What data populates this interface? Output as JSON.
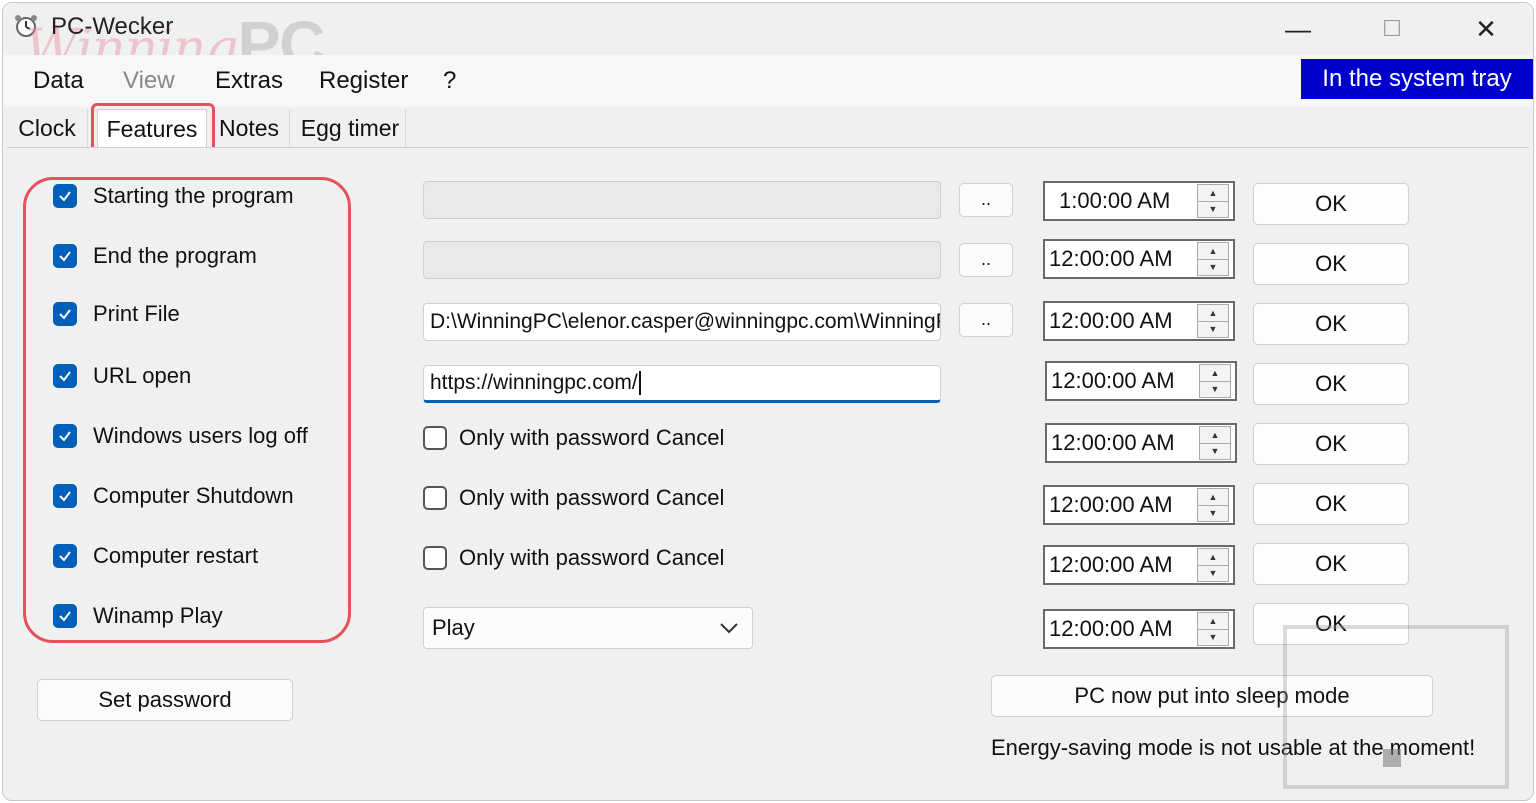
{
  "window": {
    "title": "PC-Wecker",
    "watermark_script": "Winning",
    "watermark_bold": "PC",
    "minimize": "—",
    "maximize": "☐",
    "close": "✕"
  },
  "menu": {
    "items": [
      {
        "label": "Data",
        "enabled": true
      },
      {
        "label": "View",
        "enabled": false
      },
      {
        "label": "Extras",
        "enabled": true
      },
      {
        "label": "Register",
        "enabled": true
      },
      {
        "label": "?",
        "enabled": true
      }
    ],
    "tray_button": "In the system tray"
  },
  "tabs": [
    {
      "label": "Clock",
      "active": false
    },
    {
      "label": "Features",
      "active": true
    },
    {
      "label": "Notes",
      "active": false
    },
    {
      "label": "Egg timer",
      "active": false
    }
  ],
  "features": [
    {
      "label": "Starting the program",
      "checked": true,
      "time": "1:00:00 AM",
      "ok": "OK"
    },
    {
      "label": "End the program",
      "checked": true,
      "time": "12:00:00 AM",
      "ok": "OK"
    },
    {
      "label": "Print File",
      "checked": true,
      "time": "12:00:00 AM",
      "ok": "OK"
    },
    {
      "label": "URL open",
      "checked": true,
      "time": "12:00:00 AM",
      "ok": "OK"
    },
    {
      "label": "Windows users log off",
      "checked": true,
      "time": "12:00:00 AM",
      "ok": "OK"
    },
    {
      "label": "Computer Shutdown",
      "checked": true,
      "time": "12:00:00 AM",
      "ok": "OK"
    },
    {
      "label": "Computer restart",
      "checked": true,
      "time": "12:00:00 AM",
      "ok": "OK"
    },
    {
      "label": "Winamp Play",
      "checked": true,
      "time": "12:00:00 AM",
      "ok": "OK"
    }
  ],
  "fields": {
    "start_program_path": "",
    "end_program_path": "",
    "print_file_path": "D:\\WinningPC\\elenor.casper@winningpc.com\\WinningPC",
    "url": "https://winningpc.com/",
    "browse_label": ".."
  },
  "password_options": [
    {
      "label": "Only with password Cancel",
      "checked": false
    },
    {
      "label": "Only with password Cancel",
      "checked": false
    },
    {
      "label": "Only with password Cancel",
      "checked": false
    }
  ],
  "winamp_action": {
    "selected": "Play"
  },
  "buttons": {
    "set_password": "Set password",
    "sleep_mode": "PC now put into sleep mode"
  },
  "status": "Energy-saving mode is not usable at the moment!",
  "colors": {
    "accent": "#005fb8",
    "tray_button": "#0000cc",
    "highlight": "#e8505b"
  }
}
